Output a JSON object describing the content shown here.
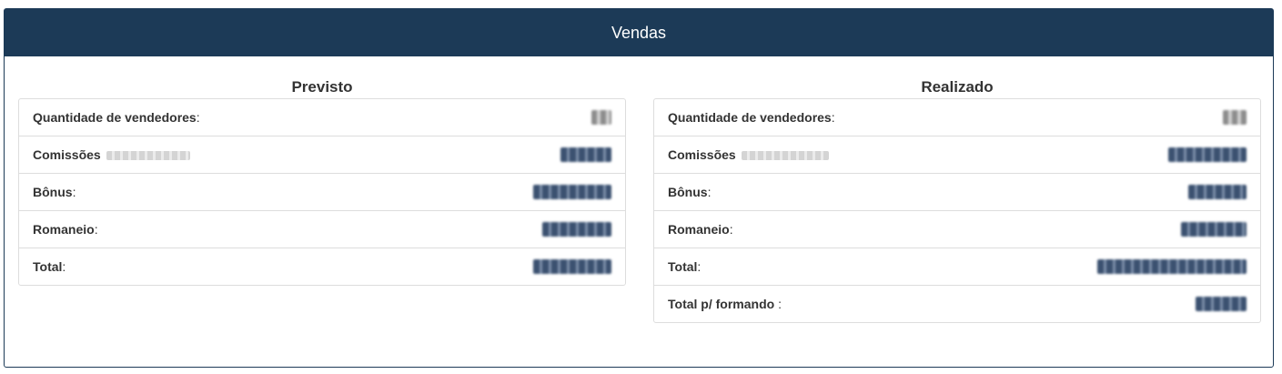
{
  "header": {
    "title": "Vendas"
  },
  "previsto": {
    "title": "Previsto",
    "rows": [
      {
        "label": "Quantidade de vendedores",
        "suffix": ":",
        "value": "",
        "value_style": "gray"
      },
      {
        "label": "Comissões",
        "suffix": "",
        "value": "",
        "value_style": "blue"
      },
      {
        "label": "Bônus",
        "suffix": ":",
        "value": "",
        "value_style": "blue"
      },
      {
        "label": "Romaneio",
        "suffix": ":",
        "value": "",
        "value_style": "blue"
      },
      {
        "label": "Total",
        "suffix": ":",
        "value": "",
        "value_style": "blue"
      }
    ]
  },
  "realizado": {
    "title": "Realizado",
    "rows": [
      {
        "label": "Quantidade de vendedores",
        "suffix": ":",
        "value": "",
        "value_style": "gray"
      },
      {
        "label": "Comissões",
        "suffix": "",
        "value": "",
        "value_style": "blue"
      },
      {
        "label": "Bônus",
        "suffix": ":",
        "value": "",
        "value_style": "blue"
      },
      {
        "label": "Romaneio",
        "suffix": ":",
        "value": "",
        "value_style": "blue"
      },
      {
        "label": "Total",
        "suffix": ":",
        "value": "",
        "value_style": "blue"
      },
      {
        "label": "Total p/ formando",
        "suffix": " :",
        "value": "",
        "value_style": "blue"
      }
    ]
  },
  "colors": {
    "header_bg": "#1c3a57",
    "border": "#dddddd",
    "text": "#333333"
  }
}
